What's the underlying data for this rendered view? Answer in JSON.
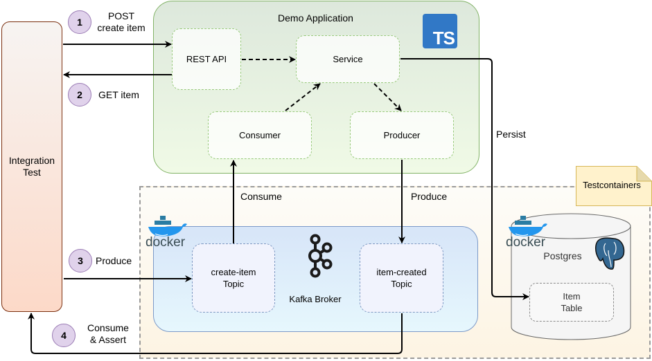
{
  "diagram": {
    "integration_test": {
      "label_line1": "Integration",
      "label_line2": "Test"
    },
    "demo_application": {
      "title": "Demo Application",
      "language_badge": "TS",
      "components": {
        "rest_api": "REST API",
        "service": "Service",
        "consumer": "Consumer",
        "producer": "Producer"
      }
    },
    "testcontainers_note": "Testcontainers",
    "kafka": {
      "broker_label": "Kafka Broker",
      "docker_label": "docker",
      "topics": [
        {
          "line1": "create-item",
          "line2": "Topic"
        },
        {
          "line1": "item-created",
          "line2": "Topic"
        }
      ]
    },
    "postgres": {
      "label": "Postgres",
      "docker_label": "docker",
      "table_line1": "Item",
      "table_line2": "Table"
    },
    "edge_labels": {
      "consume": "Consume",
      "produce": "Produce",
      "persist": "Persist"
    },
    "steps": [
      {
        "number": "1",
        "label_line1": "POST",
        "label_line2": "create item"
      },
      {
        "number": "2",
        "label_line1": "GET item",
        "label_line2": ""
      },
      {
        "number": "3",
        "label_line1": "Produce",
        "label_line2": ""
      },
      {
        "number": "4",
        "label_line1": "Consume",
        "label_line2": "& Assert"
      }
    ],
    "colors": {
      "typescript_blue": "#3178c6",
      "postgres_blue": "#336791",
      "docker_blue": "#2396ed",
      "step_circle": "#e0d2eb",
      "app_border": "#82b366",
      "kafka_border": "#7b99c8",
      "note_fill": "#fff2cc"
    }
  }
}
